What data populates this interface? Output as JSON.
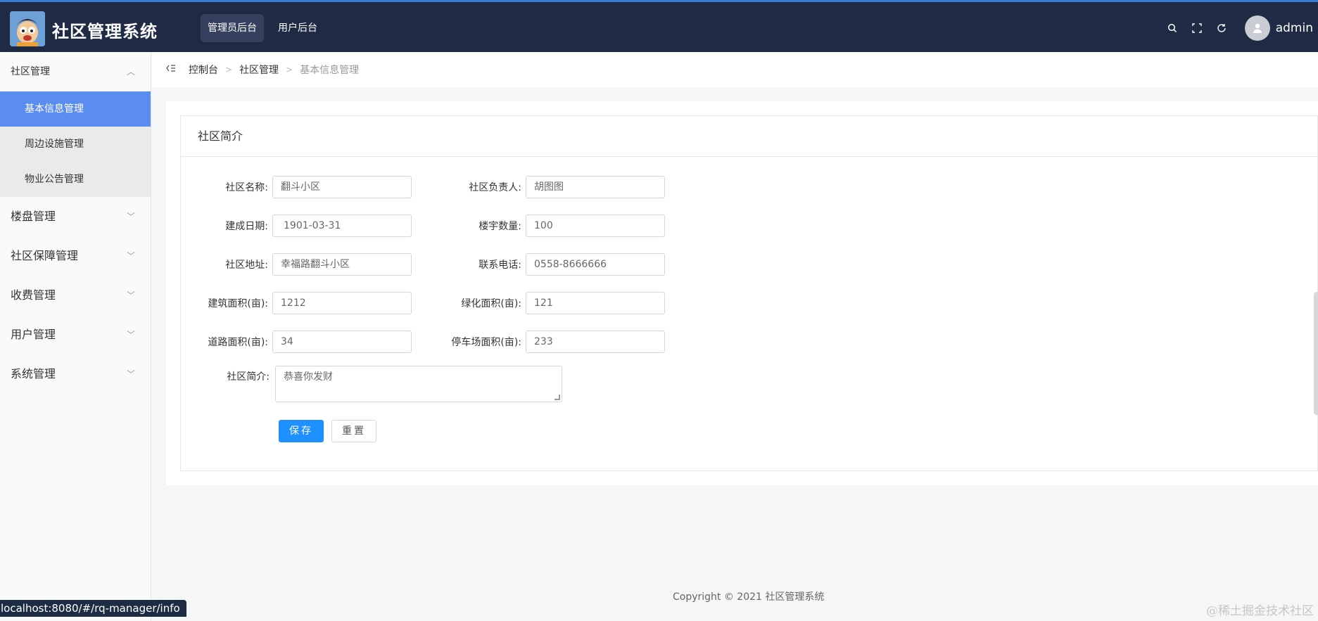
{
  "app": {
    "title": "社区管理系统"
  },
  "topnav": [
    {
      "label": "管理员后台",
      "active": true
    },
    {
      "label": "用户后台",
      "active": false
    }
  ],
  "user": {
    "name": "admin"
  },
  "sidebar": {
    "groups": [
      {
        "label": "社区管理",
        "expanded": true,
        "items": [
          {
            "label": "基本信息管理",
            "active": true
          },
          {
            "label": "周边设施管理",
            "active": false
          },
          {
            "label": "物业公告管理",
            "active": false
          }
        ]
      },
      {
        "label": "楼盘管理",
        "expanded": false
      },
      {
        "label": "社区保障管理",
        "expanded": false
      },
      {
        "label": "收费管理",
        "expanded": false
      },
      {
        "label": "用户管理",
        "expanded": false
      },
      {
        "label": "系统管理",
        "expanded": false
      }
    ]
  },
  "breadcrumb": [
    "控制台",
    "社区管理",
    "基本信息管理"
  ],
  "card": {
    "title": "社区简介"
  },
  "form": {
    "name_label": "社区名称:",
    "name_value": "翻斗小区",
    "leader_label": "社区负责人:",
    "leader_value": "胡图图",
    "built_label": "建成日期:",
    "built_value": "1901-03-31",
    "buildings_label": "楼宇数量:",
    "buildings_value": "100",
    "address_label": "社区地址:",
    "address_value": "幸福路翻斗小区",
    "phone_label": "联系电话:",
    "phone_value": "0558-8666666",
    "construct_label": "建筑面积(亩):",
    "construct_value": "1212",
    "green_label": "绿化面积(亩):",
    "green_value": "121",
    "road_label": "道路面积(亩):",
    "road_value": "34",
    "parking_label": "停车场面积(亩):",
    "parking_value": "233",
    "intro_label": "社区简介:",
    "intro_value": "恭喜你发财",
    "save_label": "保存",
    "reset_label": "重置"
  },
  "footer": {
    "copyright": "Copyright © 2021 社区管理系统"
  },
  "status": {
    "url": "localhost:8080/#/rq-manager/info"
  },
  "watermark": "@稀土掘金技术社区",
  "colors": {
    "topbar": "#1f2a44",
    "accent": "#1e90ff",
    "sidebar_active": "#5b8cf0"
  }
}
